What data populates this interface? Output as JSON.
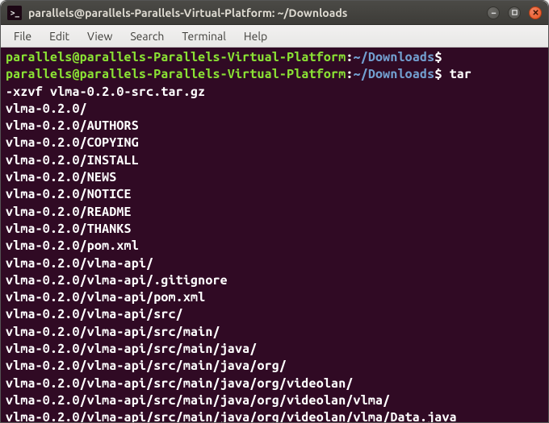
{
  "window": {
    "title": "parallels@parallels-Parallels-Virtual-Platform: ~/Downloads"
  },
  "menubar": {
    "items": [
      "File",
      "Edit",
      "View",
      "Search",
      "Terminal",
      "Help"
    ]
  },
  "terminal": {
    "prompt_user_host": "parallels@parallels-Parallels-Virtual-Platform",
    "prompt_colon": ":",
    "prompt_path": "~/Downloads",
    "prompt_dollar": "$",
    "command": "tar -xzvf vlma-0.2.0-src.tar.gz",
    "output": [
      "vlma-0.2.0/",
      "vlma-0.2.0/AUTHORS",
      "vlma-0.2.0/COPYING",
      "vlma-0.2.0/INSTALL",
      "vlma-0.2.0/NEWS",
      "vlma-0.2.0/NOTICE",
      "vlma-0.2.0/README",
      "vlma-0.2.0/THANKS",
      "vlma-0.2.0/pom.xml",
      "vlma-0.2.0/vlma-api/",
      "vlma-0.2.0/vlma-api/.gitignore",
      "vlma-0.2.0/vlma-api/pom.xml",
      "vlma-0.2.0/vlma-api/src/",
      "vlma-0.2.0/vlma-api/src/main/",
      "vlma-0.2.0/vlma-api/src/main/java/",
      "vlma-0.2.0/vlma-api/src/main/java/org/",
      "vlma-0.2.0/vlma-api/src/main/java/org/videolan/",
      "vlma-0.2.0/vlma-api/src/main/java/org/videolan/vlma/",
      "vlma-0.2.0/vlma-api/src/main/java/org/videolan/vlma/Data.java"
    ]
  }
}
